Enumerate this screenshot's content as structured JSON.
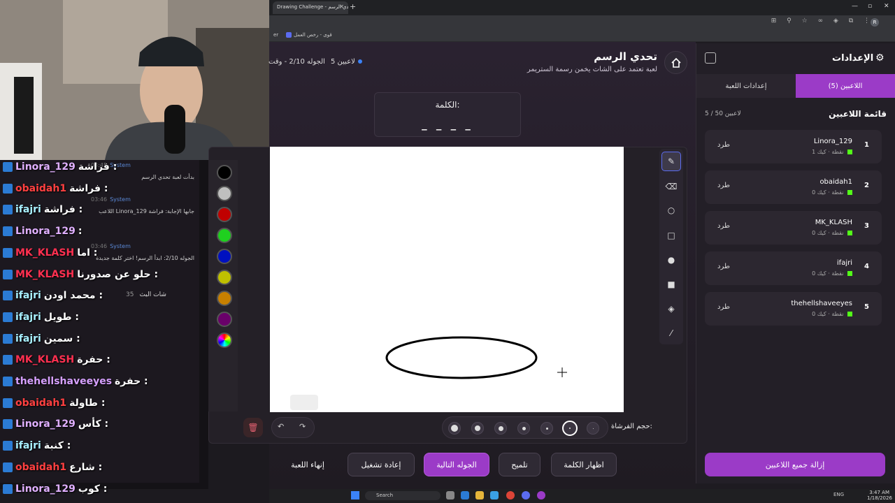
{
  "browser": {
    "tab_title": "Drawing Challenge - تحدي الرسم",
    "bookmarks": [
      "er",
      "قوى - رخص العمل"
    ],
    "profile_initial": "R"
  },
  "header": {
    "title": "تحدي الرسم",
    "subtitle": "لعبة تعتمد على الشات يخمن رسمة الستريمر",
    "players_count": "5 لاعبين",
    "round_info": "الجوله 2/10 - وقت"
  },
  "word": {
    "label": "الكلمة:",
    "blanks": "_ _ _ _"
  },
  "palette": {
    "colors": [
      "#000000",
      "#bfbfbf",
      "#c00000",
      "#1fd01f",
      "#0010c0",
      "#c0c000",
      "#c88000",
      "#6a006a",
      "rainbow"
    ]
  },
  "tools": [
    "pen-icon",
    "eraser-icon",
    "circle-outline-icon",
    "rect-outline-icon",
    "circle-fill-icon",
    "rect-fill-icon",
    "fill-bucket-icon",
    "line-icon"
  ],
  "brush": {
    "label": "حجم الفرشاة:",
    "selected_index": 5
  },
  "actions": {
    "show_word": "اظهار الكلمة",
    "hint": "تلميح",
    "next_round": "الجوله التالية",
    "restart": "إعادة تشغيل",
    "end_game": "إنهاء اللعبة"
  },
  "settings": {
    "title": "الإعدادات",
    "tab_players": "اللاعبين (5)",
    "tab_game": "إعدادات اللعبة",
    "list_title": "قائمة اللاعبين",
    "list_count": "5 / 50 لاعبين",
    "kick_label": "طرد",
    "players": [
      {
        "num": "1",
        "name": "Linora_129",
        "sub": "1 نقطة · كيك"
      },
      {
        "num": "2",
        "name": "obaidah1",
        "sub": "0 نقطة · كيك"
      },
      {
        "num": "3",
        "name": "MK_KLASH",
        "sub": "0 نقطة · كيك"
      },
      {
        "num": "4",
        "name": "ifajri",
        "sub": "0 نقطة · كيك"
      },
      {
        "num": "5",
        "name": "thehellshaveeyes",
        "sub": "0 نقطة · كيك"
      }
    ],
    "remove_all": "إزالة جميع اللاعبين"
  },
  "taskbar": {
    "search": "Search",
    "lang": "ENG",
    "time": "3:47 AM",
    "date": "1/18/2026"
  },
  "chat": {
    "header": "شات البث",
    "header_count": "35",
    "lines": [
      {
        "name": "Linora_129",
        "msg": "فراشة :",
        "color": "#e0b0ff"
      },
      {
        "name": "obaidah1",
        "msg": "فراشة :",
        "color": "#ff4040"
      },
      {
        "name": "ifajri",
        "msg": "فراشة :",
        "color": "#a8f0ff"
      },
      {
        "name": "Linora_129",
        "msg": ":",
        "color": "#e0b0ff"
      },
      {
        "name": "MK_KLASH",
        "msg": "اما :",
        "color": "#ff3050"
      },
      {
        "name": "MK_KLASH",
        "msg": "حلو عن صدورنا :",
        "color": "#ff3050"
      },
      {
        "name": "ifajri",
        "msg": "محمد اودن :",
        "color": "#a8f0ff"
      },
      {
        "name": "ifajri",
        "msg": "طويل :",
        "color": "#a8f0ff"
      },
      {
        "name": "ifajri",
        "msg": "سمين :",
        "color": "#a8f0ff"
      },
      {
        "name": "MK_KLASH",
        "msg": "حفرة :",
        "color": "#ff3050"
      },
      {
        "name": "thehellshaveeyes",
        "msg": "حفرة :",
        "color": "#d6a0ff"
      },
      {
        "name": "obaidah1",
        "msg": "طاولة :",
        "color": "#ff4040"
      },
      {
        "name": "Linora_129",
        "msg": "كأس :",
        "color": "#e0b0ff"
      },
      {
        "name": "ifajri",
        "msg": "كنبة :",
        "color": "#a8f0ff"
      },
      {
        "name": "obaidah1",
        "msg": "شارع :",
        "color": "#ff4040"
      },
      {
        "name": "Linora_129",
        "msg": "كوب :",
        "color": "#e0b0ff"
      }
    ],
    "system": [
      {
        "ts": "03:45",
        "who": "System",
        "text": "بدأت لعبة تحدي الرسم"
      },
      {
        "ts": "03:46",
        "who": "System",
        "text": "اللاعب Linora_129 جابها الإجابة: فراشة"
      },
      {
        "ts": "03:46",
        "who": "System",
        "text": "الجوله 2/10: ابدأ الرسم! اختر كلمة جديدة"
      }
    ]
  }
}
